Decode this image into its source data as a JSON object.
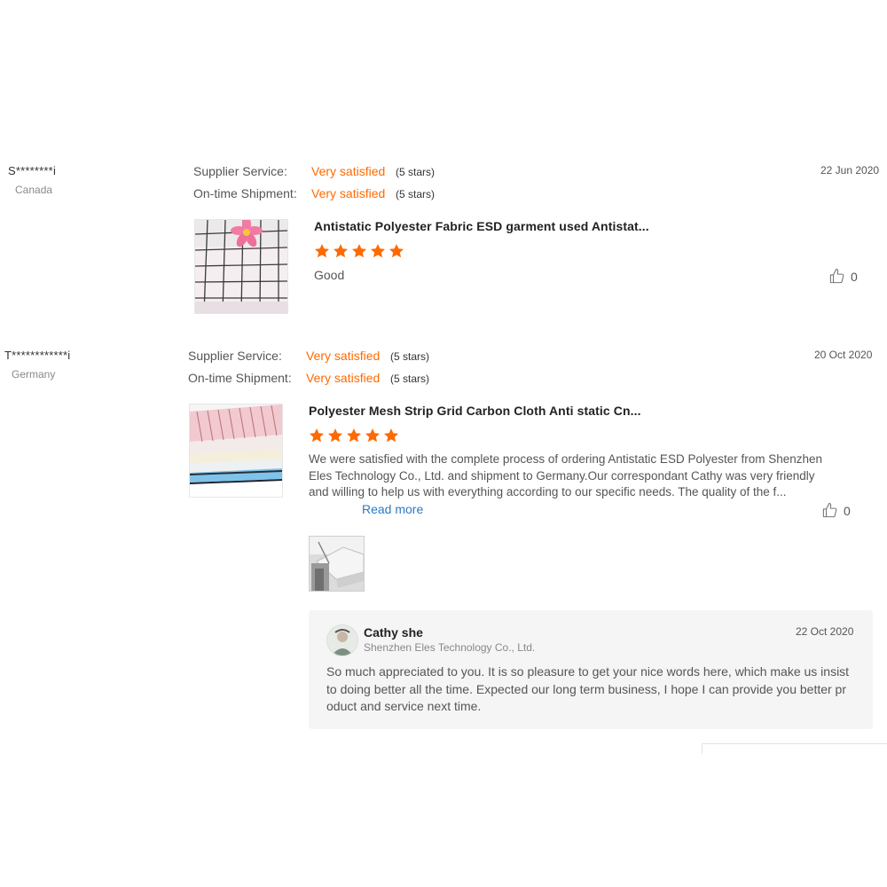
{
  "reviews": [
    {
      "username": "S********i",
      "country": "Canada",
      "date": "22 Jun 2020",
      "ratings": [
        {
          "label": "Supplier Service:",
          "value": "Very satisfied",
          "stars_text": "(5 stars)"
        },
        {
          "label": "On-time Shipment:",
          "value": "Very satisfied",
          "stars_text": "(5 stars)"
        }
      ],
      "product_title": "Antistatic Polyester Fabric ESD garment used Antistat...",
      "star_rating": 5,
      "comment": "Good",
      "likes": "0"
    },
    {
      "username": "T************i",
      "country": "Germany",
      "date": "20 Oct 2020",
      "ratings": [
        {
          "label": "Supplier Service:",
          "value": "Very satisfied",
          "stars_text": "(5 stars)"
        },
        {
          "label": "On-time Shipment:",
          "value": "Very satisfied",
          "stars_text": "(5 stars)"
        }
      ],
      "product_title": "Polyester Mesh Strip Grid Carbon Cloth Anti static Cn...",
      "star_rating": 5,
      "comment": "We were satisfied with the complete process of ordering  Antistatic ESD Polyester from Shenzhen Eles Technology Co., Ltd. and shipment to Germany.Our correspondant Cathy was very friendly and willing to help us with everything according to our specific needs. The quality of the f...",
      "read_more": "Read more",
      "likes": "0",
      "reply": {
        "name": "Cathy she",
        "company": "Shenzhen Eles Technology Co., Ltd.",
        "date": "22 Oct 2020",
        "text": "So much appreciated to you. It is so pleasure to get your nice words here, which make us insist to doing better all the time. Expected our long term business,  I hope I can provide you better product and service next time."
      }
    }
  ],
  "colors": {
    "accent": "#ff6a00",
    "link": "#2a7ac4",
    "reply_bg": "#f5f5f5"
  },
  "icons": {
    "star": "star-icon",
    "like": "thumbs-up-icon"
  }
}
